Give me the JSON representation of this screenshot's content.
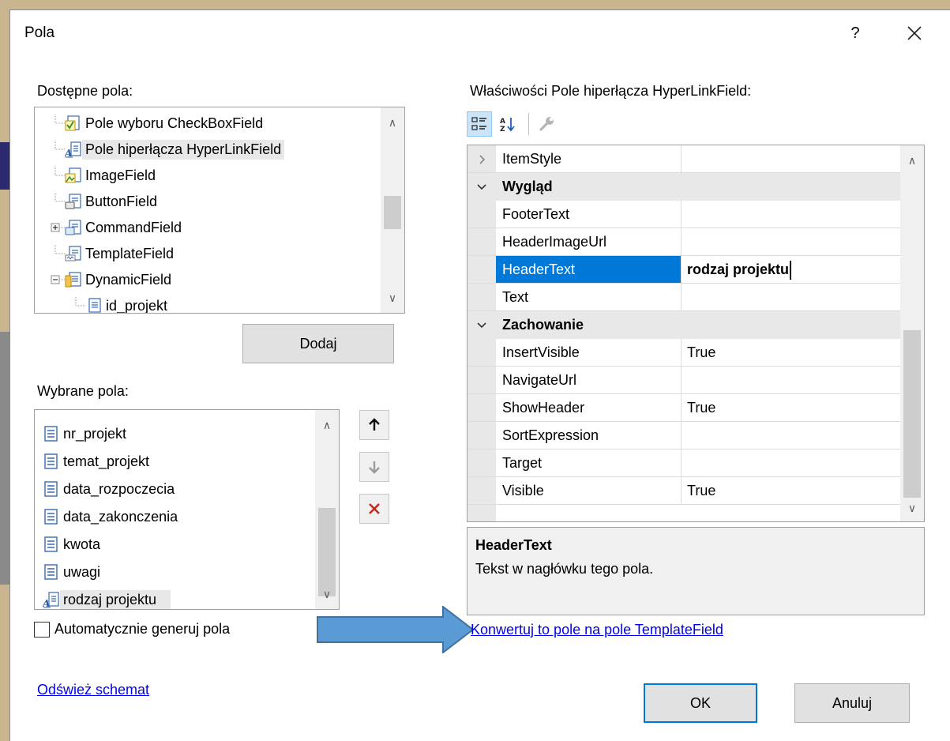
{
  "dialog": {
    "title": "Pola",
    "help_label": "?",
    "close_label": "×"
  },
  "available": {
    "label": "Dostępne pola:",
    "items": [
      {
        "label": "Pole wyboru CheckBoxField",
        "icon": "checkbox-field-icon"
      },
      {
        "label": "Pole hiperłącza HyperLinkField",
        "icon": "hyperlink-field-icon"
      },
      {
        "label": "ImageField",
        "icon": "image-field-icon"
      },
      {
        "label": "ButtonField",
        "icon": "button-field-icon"
      },
      {
        "label": "CommandField",
        "icon": "command-field-icon"
      },
      {
        "label": "TemplateField",
        "icon": "template-field-icon"
      },
      {
        "label": "DynamicField",
        "icon": "dynamic-field-icon"
      },
      {
        "label": "id_projekt",
        "icon": "field-icon"
      }
    ],
    "add_label": "Dodaj"
  },
  "selected": {
    "label": "Wybrane pola:",
    "items": [
      {
        "label": "nr_projekt",
        "icon": "bound-field-icon"
      },
      {
        "label": "temat_projekt",
        "icon": "bound-field-icon"
      },
      {
        "label": "data_rozpoczecia",
        "icon": "bound-field-icon"
      },
      {
        "label": "data_zakonczenia",
        "icon": "bound-field-icon"
      },
      {
        "label": "kwota",
        "icon": "bound-field-icon"
      },
      {
        "label": "uwagi",
        "icon": "bound-field-icon"
      },
      {
        "label": "rodzaj projektu",
        "icon": "hyperlink-field-icon"
      }
    ]
  },
  "auto_generate": {
    "label": "Automatycznie generuj pola",
    "checked": false
  },
  "refresh_link": "Odśwież schemat",
  "properties": {
    "label": "Właściwości Pole hiperłącza HyperLinkField:",
    "rows": [
      {
        "kind": "row-collapsed",
        "name": "ItemStyle",
        "value": ""
      },
      {
        "kind": "category",
        "name": "Wygląd"
      },
      {
        "kind": "row",
        "name": "FooterText",
        "value": ""
      },
      {
        "kind": "row",
        "name": "HeaderImageUrl",
        "value": ""
      },
      {
        "kind": "row-selected",
        "name": "HeaderText",
        "value": "rodzaj projektu"
      },
      {
        "kind": "row",
        "name": "Text",
        "value": ""
      },
      {
        "kind": "category",
        "name": "Zachowanie"
      },
      {
        "kind": "row",
        "name": "InsertVisible",
        "value": "True"
      },
      {
        "kind": "row",
        "name": "NavigateUrl",
        "value": ""
      },
      {
        "kind": "row",
        "name": "ShowHeader",
        "value": "True"
      },
      {
        "kind": "row",
        "name": "SortExpression",
        "value": ""
      },
      {
        "kind": "row",
        "name": "Target",
        "value": ""
      },
      {
        "kind": "row",
        "name": "Visible",
        "value": "True"
      }
    ]
  },
  "description": {
    "title": "HeaderText",
    "text": "Tekst w nagłówku tego pola."
  },
  "convert_link": "Konwertuj to pole na pole TemplateField",
  "buttons": {
    "ok": "OK",
    "cancel": "Anuluj"
  },
  "colors": {
    "accent": "#0078d7",
    "arrow_fill": "#5b9bd5",
    "arrow_stroke": "#41719c",
    "delete": "#c42b1c",
    "link": "#0000ee"
  }
}
